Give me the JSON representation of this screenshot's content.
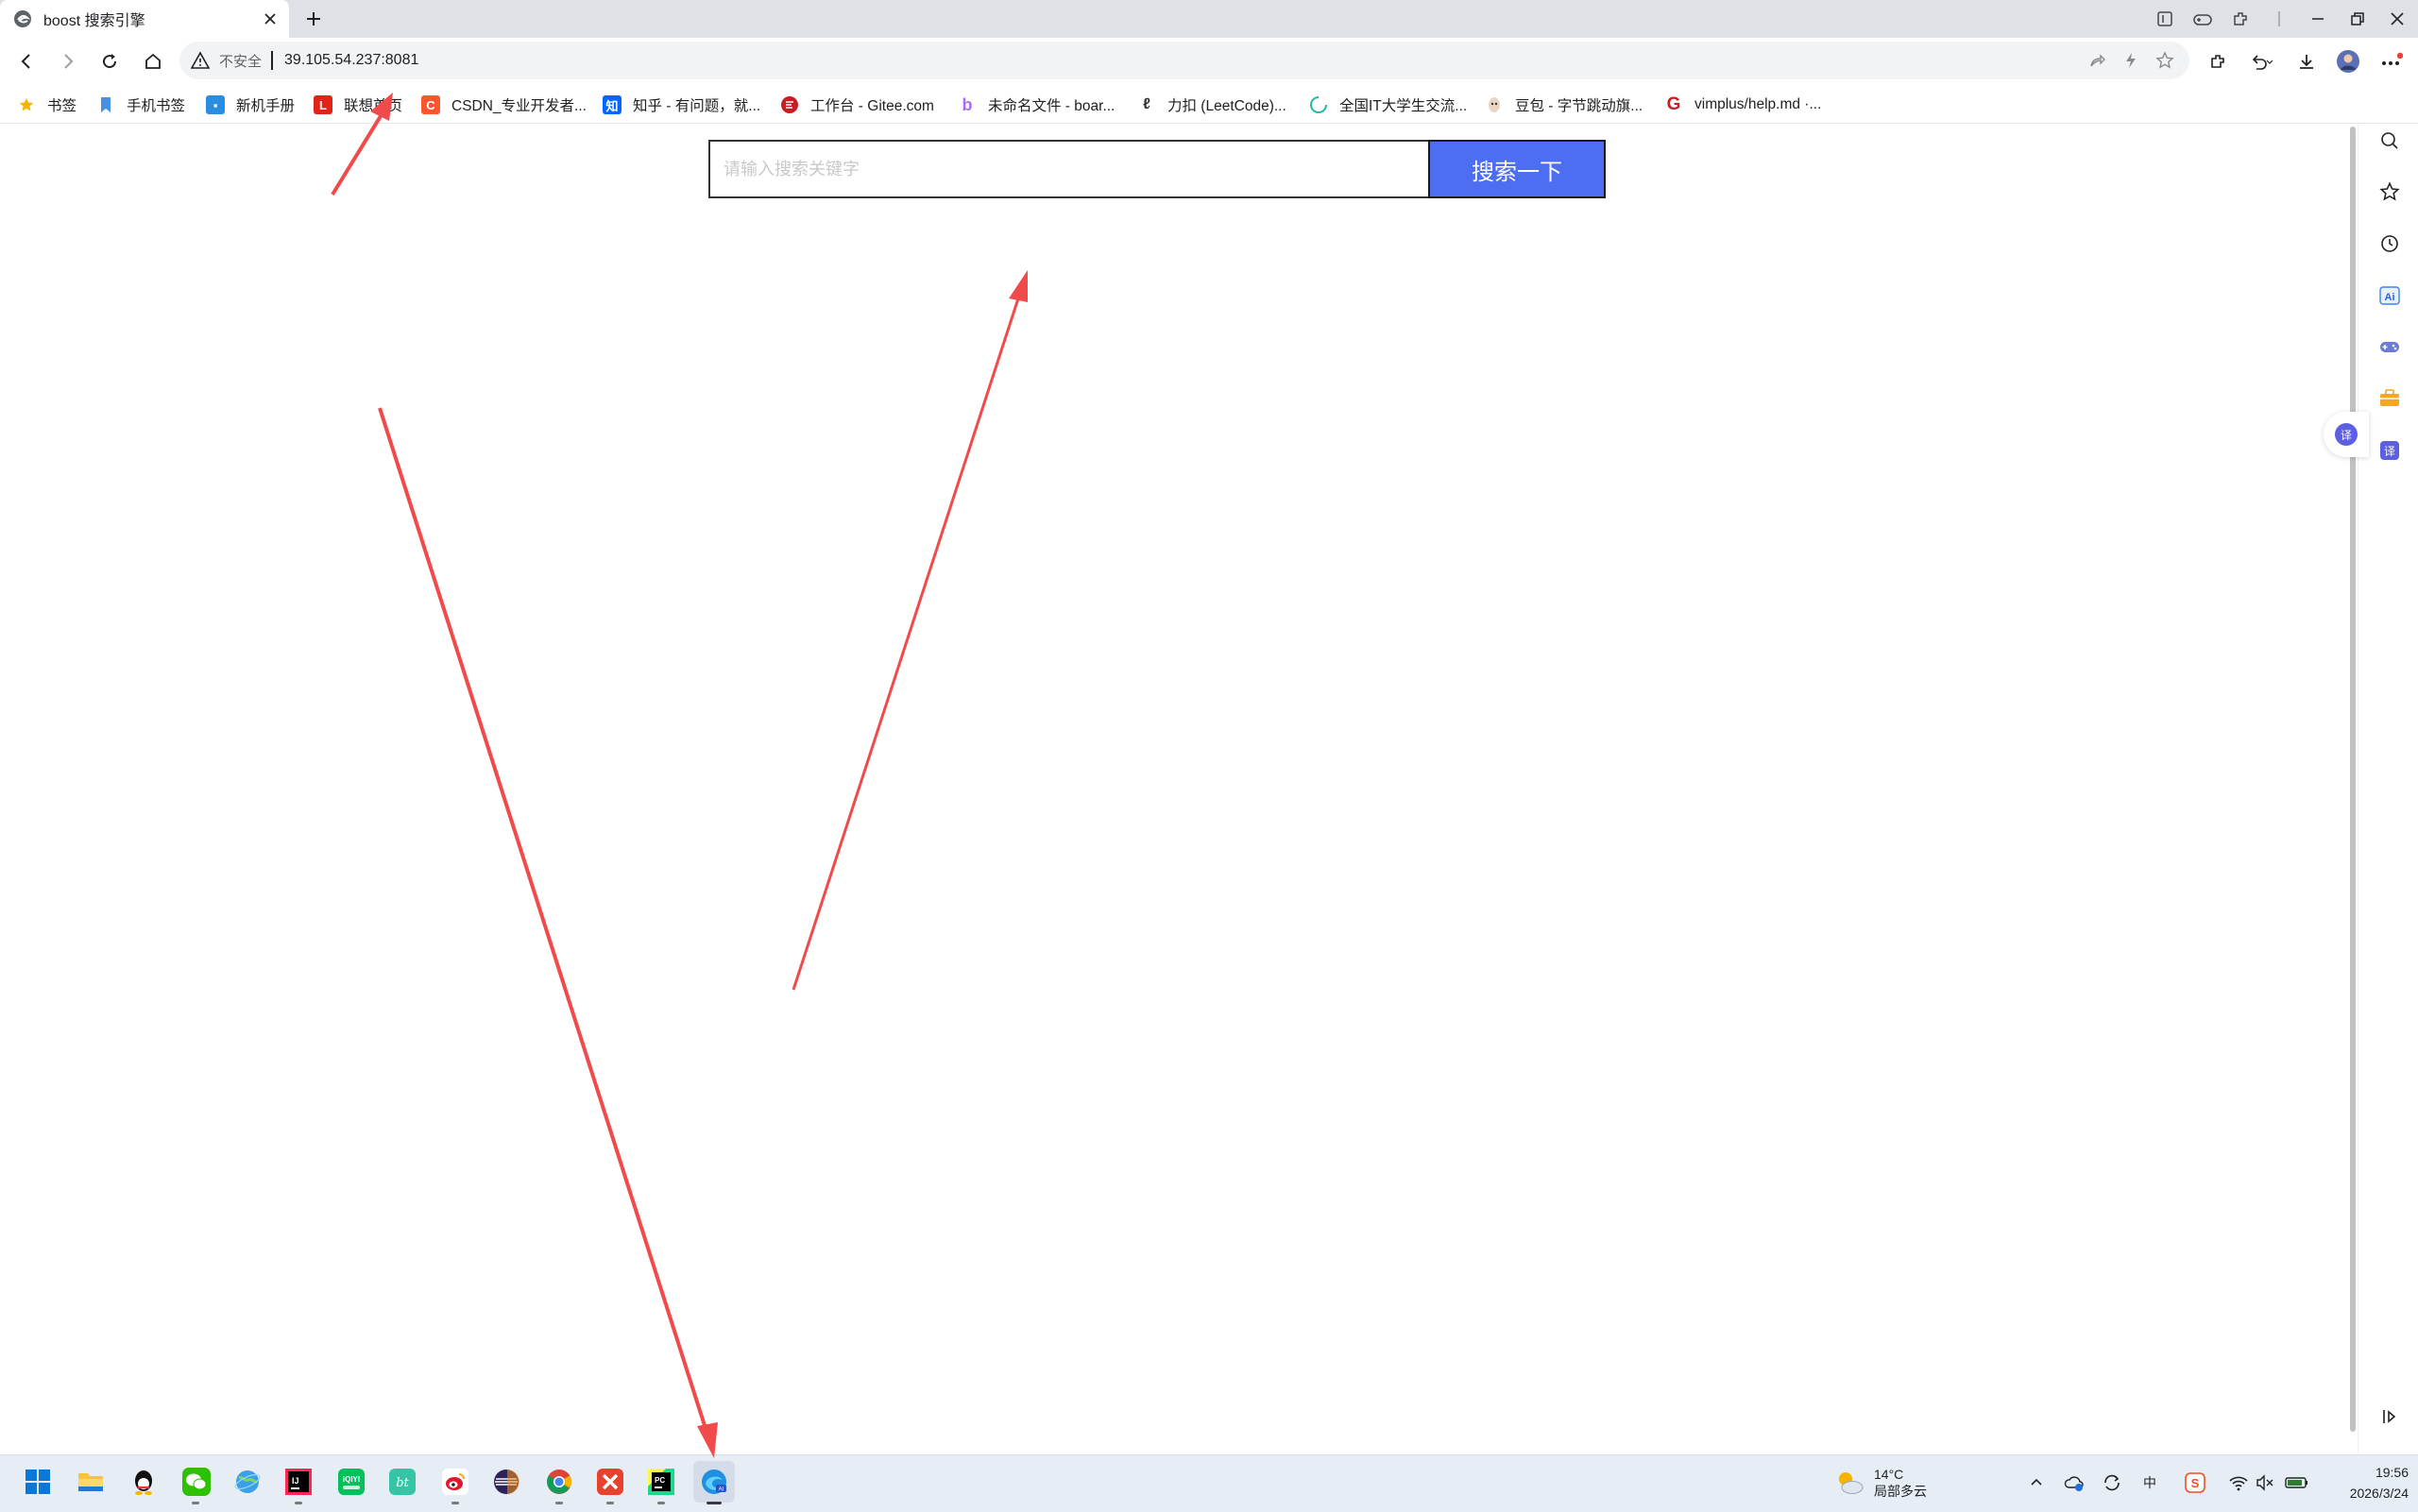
{
  "tab": {
    "title": "boost 搜索引擎"
  },
  "address_bar": {
    "security_label": "不安全",
    "url": "39.105.54.237:8081"
  },
  "bookmarks": [
    {
      "label": "书签",
      "icon": "star-icon",
      "color": "#f5b400"
    },
    {
      "label": "手机书签",
      "icon": "phone-bookmark-icon",
      "color": "#4a90e2"
    },
    {
      "label": "新机手册",
      "icon": "manual-icon",
      "color": "#2b8de0"
    },
    {
      "label": "联想首页",
      "icon": "lenovo-icon",
      "color": "#e2231a"
    },
    {
      "label": "CSDN_专业开发者...",
      "icon": "csdn-icon",
      "color": "#fc5531"
    },
    {
      "label": "知乎 - 有问题，就...",
      "icon": "zhihu-icon",
      "color": "#0066ff"
    },
    {
      "label": "工作台 - Gitee.com",
      "icon": "gitee-icon",
      "color": "#c71d23"
    },
    {
      "label": "未命名文件 - boar...",
      "icon": "boardmix-icon",
      "color": "#a86cf2"
    },
    {
      "label": "力扣 (LeetCode)...",
      "icon": "leetcode-icon",
      "color": "#333333"
    },
    {
      "label": "全国IT大学生交流...",
      "icon": "community-icon",
      "color": "#22b8a6"
    },
    {
      "label": "豆包 - 字节跳动旗...",
      "icon": "doubao-icon",
      "color": "#444444"
    },
    {
      "label": "vimplus/help.md ·...",
      "icon": "gitee-g-icon",
      "color": "#c71d23"
    }
  ],
  "search": {
    "placeholder": "请输入搜索关键字",
    "button_label": "搜索一下"
  },
  "colors": {
    "accent": "#4e6ef2",
    "annotation_red": "#f04a4a"
  },
  "weather": {
    "temperature": "14°C",
    "description": "局部多云"
  },
  "clock": {
    "time": "19:56",
    "date": "2026/3/24"
  },
  "taskbar_apps": [
    "windows-start-icon",
    "file-explorer-icon",
    "qq-icon",
    "wechat-icon",
    "browser-globe-icon",
    "intellij-idea-icon",
    "iqiyi-icon",
    "bt-icon",
    "weibo-icon",
    "eclipse-icon",
    "chrome-icon",
    "xmind-icon",
    "pycharm-icon",
    "edge-ai-browser-icon"
  ]
}
